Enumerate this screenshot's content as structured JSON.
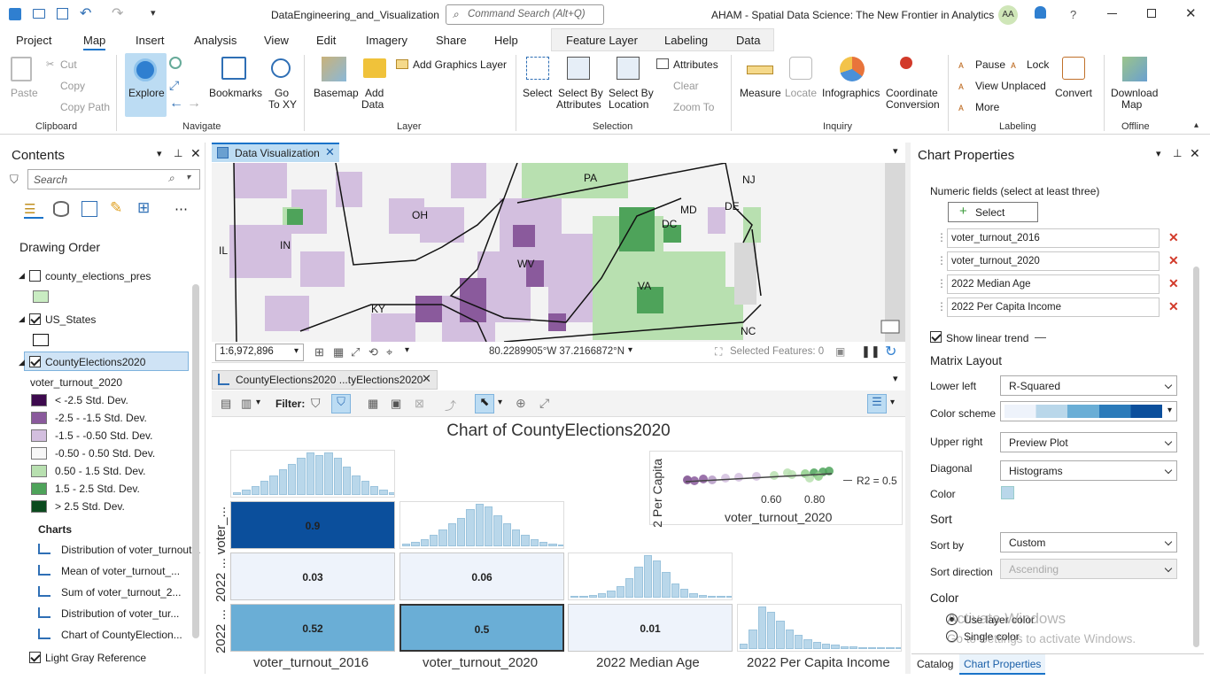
{
  "titlebar": {
    "project_name": "DataEngineering_and_Visualization",
    "search_placeholder": "Command Search (Alt+Q)",
    "app_title": "AHAM - Spatial Data Science:  The New Frontier in Analytics",
    "user_initials": "AA",
    "help": "?"
  },
  "tabs": [
    "Project",
    "Map",
    "Insert",
    "Analysis",
    "View",
    "Edit",
    "Imagery",
    "Share",
    "Help"
  ],
  "context_tabs": [
    "Feature Layer",
    "Labeling",
    "Data"
  ],
  "ribbon": {
    "clipboard": {
      "group": "Clipboard",
      "paste": "Paste",
      "cut": "Cut",
      "copy": "Copy",
      "copy_path": "Copy Path"
    },
    "navigate": {
      "group": "Navigate",
      "explore": "Explore",
      "bookmarks": "Bookmarks",
      "go_to_xy": "Go\nTo XY",
      "go": "Go",
      "to_xy": "To XY"
    },
    "layer": {
      "group": "Layer",
      "basemap": "Basemap",
      "add_data": "Add",
      "add_data2": "Data",
      "add_graphics": "Add Graphics Layer"
    },
    "selection": {
      "group": "Selection",
      "select": "Select",
      "select_by_attr1": "Select By",
      "select_by_attr2": "Attributes",
      "select_by_loc1": "Select By",
      "select_by_loc2": "Location",
      "attributes": "Attributes",
      "clear": "Clear",
      "zoom_to": "Zoom To"
    },
    "inquiry": {
      "group": "Inquiry",
      "measure": "Measure",
      "locate": "Locate",
      "infographics": "Infographics",
      "coord1": "Coordinate",
      "coord2": "Conversion"
    },
    "labeling": {
      "group": "Labeling",
      "pause": "Pause",
      "lock": "Lock",
      "view_unplaced": "View Unplaced",
      "more": "More",
      "convert": "Convert"
    },
    "offline": {
      "group": "Offline",
      "download1": "Download",
      "download2": "Map"
    }
  },
  "contents": {
    "title": "Contents",
    "search_placeholder": "Search",
    "drawing_order": "Drawing Order",
    "layers": [
      {
        "name": "county_elections_pres",
        "checked": false
      },
      {
        "name": "US_States",
        "checked": true
      },
      {
        "name": "CountyElections2020",
        "checked": true
      }
    ],
    "legend_field": "voter_turnout_2020",
    "legend": [
      {
        "label": "< -2.5 Std. Dev.",
        "color": "#3d0a4e"
      },
      {
        "label": "-2.5 - -1.5 Std. Dev.",
        "color": "#8a5a9c"
      },
      {
        "label": "-1.5 - -0.50 Std. Dev.",
        "color": "#d3bfdf"
      },
      {
        "label": "-0.50 - 0.50 Std. Dev.",
        "color": "#f7f7f7"
      },
      {
        "label": "0.50 - 1.5 Std. Dev.",
        "color": "#b8e0b0"
      },
      {
        "label": "1.5 - 2.5 Std. Dev.",
        "color": "#4ea35a"
      },
      {
        "label": "> 2.5 Std. Dev.",
        "color": "#0b4a1e"
      }
    ],
    "charts_header": "Charts",
    "charts": [
      "Distribution of voter_turnout...",
      "Mean of voter_turnout_...",
      "Sum of voter_turnout_2...",
      "Distribution of voter_tur...",
      "Chart of CountyElection..."
    ],
    "basemap": "Light Gray Reference"
  },
  "mapview": {
    "tab": "Data Visualization",
    "scale": "1:6,972,896",
    "coords": "80.2289905°W 37.2166872°N",
    "selected_features": "Selected Features: 0",
    "state_labels": [
      "PA",
      "NJ",
      "OH",
      "MD",
      "DE",
      "DC",
      "IN",
      "IL",
      "WV",
      "VA",
      "KY",
      "NC"
    ]
  },
  "chartview": {
    "tab": "CountyElections2020 ...tyElections2020",
    "filter_label": "Filter:",
    "title": "Chart of CountyElections2020",
    "matrix": [
      {
        "row": "voter_...",
        "values": [
          0.9
        ]
      },
      {
        "row": "2022 ...",
        "values": [
          0.03,
          0.06
        ]
      },
      {
        "row": "2022 ...",
        "values": [
          0.52,
          0.5,
          0.01
        ]
      }
    ],
    "cell_labels": [
      "0.9",
      "0.03",
      "0.06",
      "0.52",
      "0.5",
      "0.01"
    ],
    "x_labels": [
      "voter_turnout_2016",
      "voter_turnout_2020",
      "2022 Median Age",
      "2022 Per Capita Income"
    ],
    "preview": {
      "ylabel": "2 Per Capita",
      "xlabel": "voter_turnout_2020",
      "tick1": "0.60",
      "tick2": "0.80",
      "legend": "R2 = 0.5"
    }
  },
  "chart_properties": {
    "title": "Chart Properties",
    "numeric_label": "Numeric fields (select at least three)",
    "select_button": "Select",
    "fields": [
      "voter_turnout_2016",
      "voter_turnout_2020",
      "2022 Median Age",
      "2022 Per Capita Income"
    ],
    "show_trend": "Show linear trend",
    "matrix_layout": "Matrix Layout",
    "lower_left_label": "Lower left",
    "lower_left": "R-Squared",
    "color_scheme_label": "Color scheme",
    "upper_right_label": "Upper right",
    "upper_right": "Preview Plot",
    "diagonal_label": "Diagonal",
    "diagonal": "Histograms",
    "color_label": "Color",
    "sort_header": "Sort",
    "sort_by_label": "Sort by",
    "sort_by": "Custom",
    "sort_dir_label": "Sort direction",
    "sort_dir": "Ascending",
    "color_header": "Color",
    "use_layer_color": "Use layer color",
    "single_color": "Single color",
    "watermark1": "Activate Windows",
    "watermark2": "Go to Settings to activate Windows.",
    "bottom_tabs": [
      "Catalog",
      "Chart Properties"
    ]
  },
  "colors": {
    "accent": "#1a73c9",
    "cell_dark": "#0b4f9c",
    "cell_mid": "#6aaed6",
    "cell_light": "#eef3fb",
    "hist": "#b9d7ea"
  }
}
